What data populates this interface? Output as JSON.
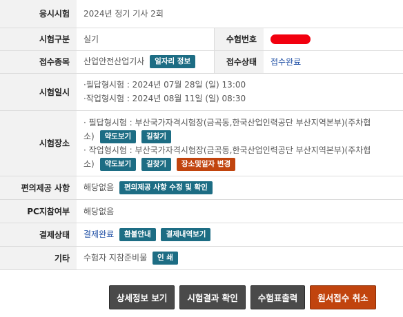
{
  "rows": {
    "exam": {
      "label": "응시시험",
      "value": "2024년 정기 기사 2회"
    },
    "type": {
      "label": "시험구분",
      "value": "실기",
      "num_label": "수험번호"
    },
    "field": {
      "label": "접수종목",
      "value": "산업안전산업기사",
      "job_btn": "일자리 정보",
      "status_label": "접수상태",
      "status_value": "접수완료"
    },
    "datetime": {
      "label": "시험일시",
      "written": "·필답형시험 : 2024년 07월 28일 (일) 13:00",
      "practical": "·작업형시험 : 2024년 08월 11일 (일) 08:30"
    },
    "place": {
      "label": "시험장소",
      "written_a": "· 필답형시험 : 부산국가자격시험장(금곡동,한국산업인력공단 부산지역본부)(주차협",
      "written_b": "소)",
      "practical_a": "· 작업형시험 : 부산국가자격시험장(금곡동,한국산업인력공단 부산지역본부)(주차협",
      "practical_b": "소)",
      "map_btn": "약도보기",
      "route_btn": "길찾기",
      "change_btn": "장소및일자 변경"
    },
    "convenience": {
      "label": "편의제공 사항",
      "value": "해당없음",
      "btn": "편의제공 사항 수정 및 확인"
    },
    "pc": {
      "label": "PC지참여부",
      "value": "해당없음"
    },
    "payment": {
      "label": "결제상태",
      "value": "결제완료",
      "refund_btn": "환불안내",
      "history_btn": "결제내역보기"
    },
    "etc": {
      "label": "기타",
      "value": "수험자 지참준비물",
      "print_btn": "인 쇄"
    }
  },
  "footer": {
    "detail": "상세정보 보기",
    "result": "시험결과 확인",
    "ticket": "수험표출력",
    "cancel": "원서접수 취소"
  },
  "colors": {
    "teal": "#1d6d84",
    "orange": "#c1440e",
    "gray": "#4a4a4a",
    "label_bg": "#f2f2f2",
    "redaction": "#f2000f"
  }
}
